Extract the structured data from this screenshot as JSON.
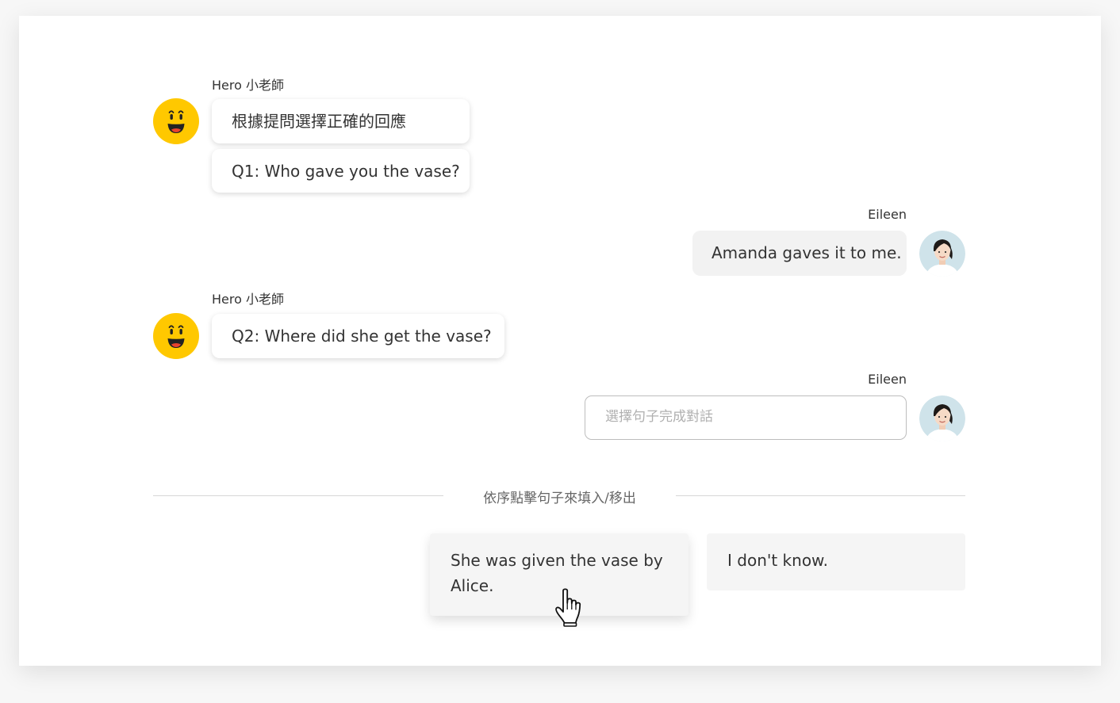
{
  "bot": {
    "name": "Hero 小老師",
    "avatar_icon": "smiley-face-icon",
    "avatar_color": "#FFC800"
  },
  "user": {
    "name": "Eileen",
    "avatar_icon": "user-photo-avatar"
  },
  "messages": {
    "instruction": "根據提問選擇正確的回應",
    "q1": "Q1: Who gave you the vase?",
    "a1": "Amanda gaves it to me.",
    "q2": "Q2: Where did she get the vase?"
  },
  "answer_input": {
    "placeholder": "選擇句子完成對話"
  },
  "divider": {
    "label": "依序點擊句子來填入/移出"
  },
  "options": [
    {
      "label": "She was given the vase by Alice."
    },
    {
      "label": "I don't know."
    }
  ],
  "cursor_icon": "hand-pointer-icon"
}
